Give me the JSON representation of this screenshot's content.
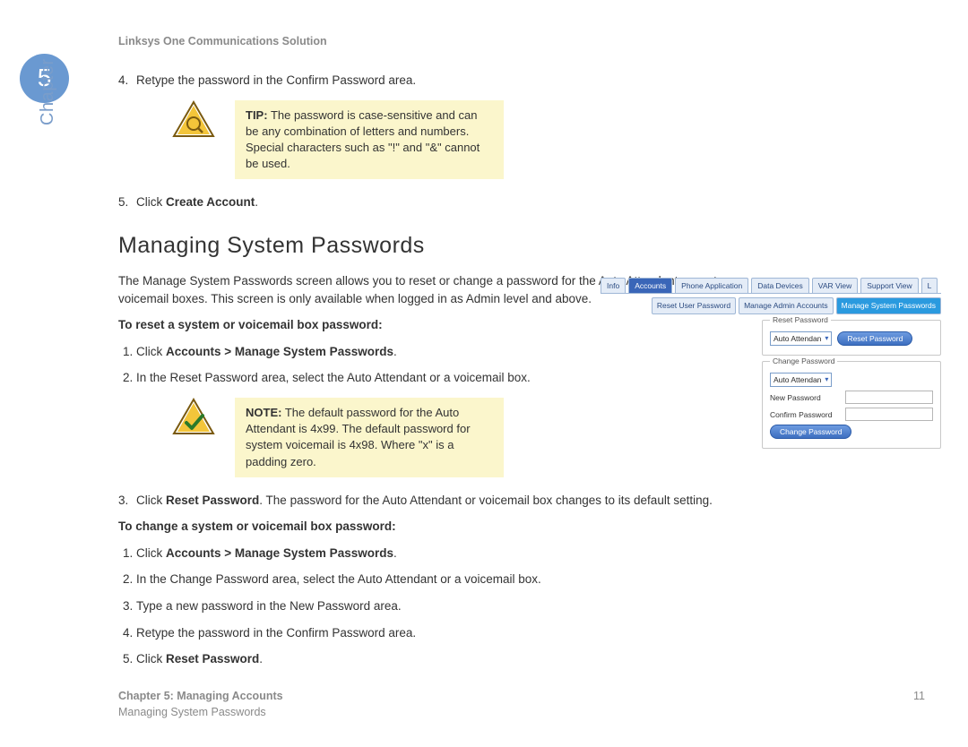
{
  "header": {
    "title": "Linksys One Communications Solution"
  },
  "chapter": {
    "number": "5",
    "label": "Chapter"
  },
  "intro_steps": {
    "s4": "Retype the password in the Confirm Password area.",
    "s5_pre": "Click ",
    "s5_bold": "Create Account",
    "s5_post": "."
  },
  "tip": {
    "label": "TIP:",
    "text": " The password is case-sensitive and can be any combination of letters and numbers. Special characters such as \"!\" and \"&\" cannot be used."
  },
  "heading": "Managing System Passwords",
  "lead": "The Manage System Passwords screen allows you to reset or change a password for the Auto Attendant or system voicemail boxes. This screen is only available when logged in as Admin level and above.",
  "reset": {
    "subhead": "To reset a system or voicemail box password:",
    "s1_pre": "Click ",
    "s1_bold": "Accounts > Manage System Passwords",
    "s1_post": ".",
    "s2": "In the Reset Password area, select the Auto Attendant or a voicemail box.",
    "s3_pre": "Click ",
    "s3_bold": "Reset Password",
    "s3_post": ". The password for the Auto Attendant or voicemail box changes to its default setting."
  },
  "note": {
    "label": "NOTE:",
    "text": " The default password for the Auto Attendant is 4x99. The default password for system voicemail is 4x98. Where \"x\" is a padding zero."
  },
  "change": {
    "subhead": "To change a system or voicemail box password:",
    "s1_pre": "Click ",
    "s1_bold": "Accounts > Manage System Passwords",
    "s1_post": ".",
    "s2": "In the Change Password area, select the Auto Attendant or a voicemail box.",
    "s3": "Type a new password in the New Password area.",
    "s4": "Retype the password in the Confirm Password area.",
    "s5_pre": "Click ",
    "s5_bold": "Reset Password",
    "s5_post": "."
  },
  "footer": {
    "l1": "Chapter 5: Managing Accounts",
    "l2": "Managing System Passwords",
    "page": "11"
  },
  "ui": {
    "tabs": {
      "info": "Info",
      "accounts": "Accounts",
      "phone": "Phone Application",
      "data": "Data Devices",
      "var": "VAR View",
      "support": "Support View",
      "extra": "L"
    },
    "subtabs": {
      "reset_user": "Reset User Password",
      "manage_admin": "Manage Admin Accounts",
      "manage_sys": "Manage System Passwords"
    },
    "group_reset": {
      "title": "Reset Password",
      "select_value": "Auto Attendan",
      "button": "Reset Password"
    },
    "group_change": {
      "title": "Change Password",
      "select_value": "Auto Attendan",
      "new_pw_label": "New Password",
      "confirm_pw_label": "Confirm Password",
      "button": "Change Password"
    }
  }
}
